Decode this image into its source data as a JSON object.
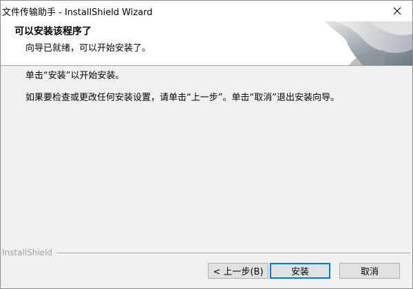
{
  "window": {
    "title": "文件传输助手 - InstallShield Wizard",
    "close_glyph": "✕"
  },
  "header": {
    "title": "可以安装该程序了",
    "subtitle": "向导已就绪，可以开始安装了。"
  },
  "body": {
    "line1": "单击“安装”以开始安装。",
    "line2": "如果要检查或更改任何安装设置，请单击“上一步”。单击“取消”退出安装向导。"
  },
  "footer": {
    "brand": "InstallShield",
    "back_label": "< 上一步(B)",
    "install_label": "安装",
    "cancel_label": "取消"
  },
  "colors": {
    "window_bg": "#f0f0f0",
    "header_bg": "#ffffff",
    "default_button_border": "#0078d7",
    "brand_text": "#a0a0a0"
  },
  "icons": {
    "close": "close-icon",
    "header_graphic": "installshield-logo-graphic"
  }
}
